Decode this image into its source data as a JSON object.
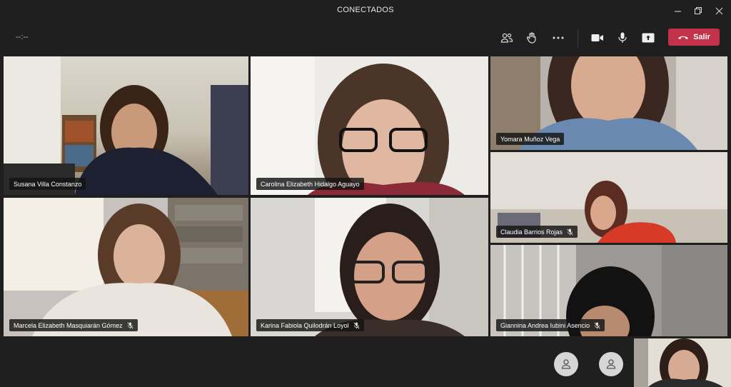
{
  "window": {
    "title": "CONECTADOS",
    "minimize_icon": "minimize-icon",
    "maximize_icon": "restore-icon",
    "close_icon": "close-icon"
  },
  "toolbar": {
    "call_timer": "--:--",
    "icons": [
      "participants-icon",
      "raise-hand-icon",
      "more-options-icon",
      "camera-icon",
      "microphone-icon",
      "share-screen-icon"
    ],
    "leave_label": "Salir",
    "leave_color": "#c4314b"
  },
  "participants": [
    {
      "name": "Susana Villa Constanzo",
      "muted": false
    },
    {
      "name": "Carolina Elizabeth Hidalgo Aguayo",
      "muted": false
    },
    {
      "name": "Yomara Muñoz Vega",
      "muted": false
    },
    {
      "name": "Marcela Elizabeth Masquiarán Gómez",
      "muted": true
    },
    {
      "name": "Karina Fabiola Quilodrán Loyol",
      "muted": true
    },
    {
      "name": "Claudia Barrios Rojas",
      "muted": true
    },
    {
      "name": "Giannina Andrea Iubini Asencio",
      "muted": true
    }
  ],
  "overflow": {
    "avatar_icons": [
      "person-icon",
      "person-icon"
    ]
  }
}
